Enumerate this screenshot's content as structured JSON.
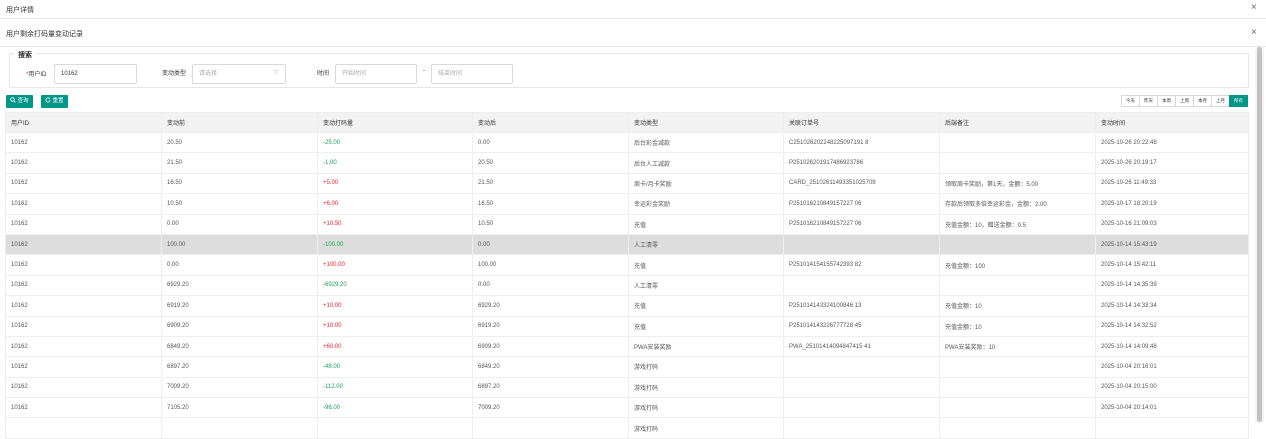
{
  "modal": {
    "title": "用户详情"
  },
  "panel": {
    "title": "用户剩余打码量变动记录"
  },
  "search": {
    "legend": "搜索",
    "user_id_label": "用户ID",
    "user_id_value": "10162",
    "type_label": "变动类型",
    "type_placeholder": "请选择",
    "time_label": "时间",
    "start_placeholder": "开始时间",
    "range_sep": "-",
    "end_placeholder": "结束时间"
  },
  "actions": {
    "query": "查询",
    "reset": "重置"
  },
  "presets": [
    {
      "label": "今天",
      "active": false
    },
    {
      "label": "昨天",
      "active": false
    },
    {
      "label": "本周",
      "active": false
    },
    {
      "label": "上周",
      "active": false
    },
    {
      "label": "本月",
      "active": false
    },
    {
      "label": "上月",
      "active": false
    },
    {
      "label": "所有",
      "active": true
    }
  ],
  "table": {
    "columns": [
      "用户ID",
      "变动前",
      "变动打码量",
      "变动后",
      "变动类型",
      "关联订单号",
      "后端备注",
      "变动时间"
    ],
    "rows": [
      [
        "10162",
        "20.50",
        "-25.00",
        "0.00",
        "后台彩金减款",
        "C251026202248225097191 8",
        "",
        "2025-10-26 20:22:48"
      ],
      [
        "10162",
        "21.50",
        "-1.00",
        "20.50",
        "后台人工减款",
        "P251026201917486923786",
        "",
        "2025-10-26 20:19:17"
      ],
      [
        "10162",
        "16.50",
        "+5.00",
        "21.50",
        "周卡/月卡奖励",
        "CARD_25102611493351025709",
        "领取周卡奖励，第1天，金额：5.00",
        "2025-10-26 11:49:33"
      ],
      [
        "10162",
        "10.50",
        "+6.00",
        "16.50",
        "幸运彩金奖励",
        "P251016210849157227 06",
        "存款后领取多倍幸运彩金，金额：2.00",
        "2025-10-17 18:20:19"
      ],
      [
        "10162",
        "0.00",
        "+10.50",
        "10.50",
        "充值",
        "P251016210849157227 06",
        "充值金额：10，赠送金额：0.5",
        "2025-10-16 21:09:03"
      ],
      [
        "10162",
        "100.00",
        "-100.00",
        "0.00",
        "人工清零",
        "",
        "",
        "2025-10-14 15:43:19"
      ],
      [
        "10162",
        "0.00",
        "+100.00",
        "100.00",
        "充值",
        "P251014154155742393 82",
        "充值金额：100",
        "2025-10-14 15:42:11"
      ],
      [
        "10162",
        "6929.20",
        "-6929.20",
        "0.00",
        "人工清零",
        "",
        "",
        "2025-10-14 14:35:39"
      ],
      [
        "10162",
        "6919.20",
        "+10.00",
        "6929.20",
        "充值",
        "P251014143324100846 13",
        "充值金额：10",
        "2025-10-14 14:33:34"
      ],
      [
        "10162",
        "6909.20",
        "+10.00",
        "6919.20",
        "充值",
        "P251014143226777728 45",
        "充值金额：10",
        "2025-10-14 14:32:52"
      ],
      [
        "10162",
        "6849.20",
        "+60.00",
        "6909.20",
        "PWA安装奖励",
        "PWA_25101414094847415 41",
        "PWA安装奖励：10",
        "2025-10-14 14:09:48"
      ],
      [
        "10162",
        "6897.20",
        "-48.00",
        "6849.20",
        "游戏打码",
        "",
        "",
        "2025-10-04 20:16:01"
      ],
      [
        "10162",
        "7009.20",
        "-112.00",
        "6897.20",
        "游戏打码",
        "",
        "",
        "2025-10-04 20:15:00"
      ],
      [
        "10162",
        "7105.20",
        "-96.00",
        "7009.20",
        "游戏打码",
        "",
        "",
        "2025-10-04 20:14:01"
      ],
      [
        "",
        "",
        "",
        "",
        "游戏打码",
        "",
        "",
        ""
      ]
    ],
    "highlight_row": 5
  },
  "colors": {
    "accent": "#009688",
    "negative": "#18a058",
    "positive": "#f5222d",
    "row_highlight": "#dddddd"
  }
}
